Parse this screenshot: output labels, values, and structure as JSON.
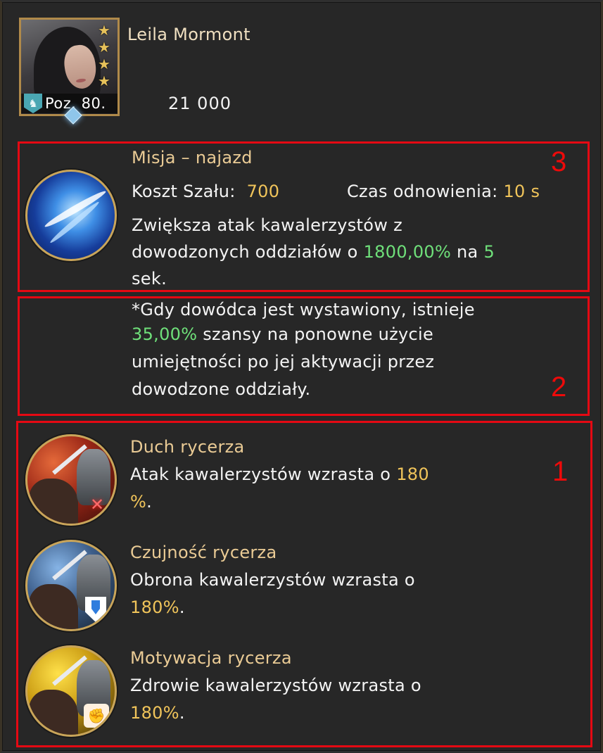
{
  "hero": {
    "name": "Leila Mormont",
    "level_label": "Poz. 80.",
    "power": "21 000",
    "stars": 4
  },
  "box_labels": {
    "box3": "3",
    "box2": "2",
    "box1": "1"
  },
  "main_skill": {
    "title": "Misja – najazd",
    "cost_label": "Koszt Szału:",
    "cost_value": "700",
    "cooldown_label": "Czas odnowienia:",
    "cooldown_value": "10 s",
    "desc_line1": "Zwiększa atak kawalerzystów z",
    "desc_line2_pre": "dowodzonych oddziałów o ",
    "desc_line2_pct": "1800,00%",
    "desc_line2_mid": " na ",
    "desc_line2_sec": "5",
    "desc_line3": "sek."
  },
  "bonus": {
    "line1": "*Gdy dowódca jest wystawiony, istnieje",
    "line2_pct": "35,00%",
    "line2_rest": " szansy na ponowne użycie",
    "line3": "umiejętności po jej aktywacji przez",
    "line4": "dowodzone oddziały."
  },
  "passives": [
    {
      "title": "Duch rycerza",
      "line1_pre": "Atak kawalerzystów wzrasta o ",
      "line1_val": "180",
      "line2_val": "%",
      "line2_end": ".",
      "icon": "red-swords-icon"
    },
    {
      "title": "Czujność rycerza",
      "line1_pre": "Obrona kawalerzystów wzrasta o",
      "line2_val": "180%",
      "line2_end": ".",
      "icon": "shield-icon"
    },
    {
      "title": "Motywacja rycerza",
      "line1_pre": "Zdrowie kawalerzystów wzrasta o",
      "line2_val": "180%",
      "line2_end": ".",
      "icon": "fist-icon"
    }
  ],
  "colors": {
    "accent_gold": "#f0c45a",
    "accent_green": "#6fe07a",
    "title": "#eacb95",
    "annotation_red": "#e50913",
    "background": "#262626"
  }
}
